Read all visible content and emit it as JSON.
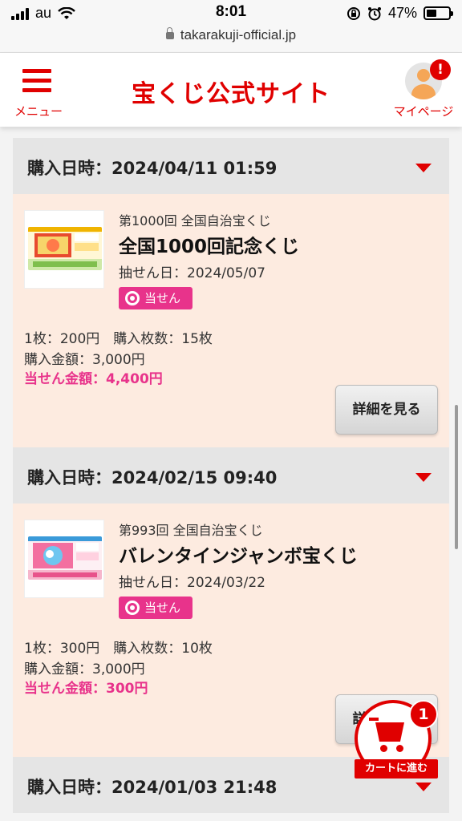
{
  "status_bar": {
    "carrier": "au",
    "time": "8:01",
    "battery": "47%",
    "battery_level": 0.47
  },
  "url_bar": {
    "url": "takarakuji-official.jp"
  },
  "header": {
    "menu_label": "メニュー",
    "logo": "宝くじ公式サイト",
    "mypage_label": "マイページ",
    "mypage_badge": "!"
  },
  "purchases": [
    {
      "date_label": "購入日時：2024/04/11 01:59",
      "series": "第1000回 全国自治宝くじ",
      "name": "全国1000回記念くじ",
      "draw_date": "抽せん日：2024/05/07",
      "result_badge": "当せん",
      "unit_info": "1枚：200円　購入枚数：15枚",
      "total": "購入金額：3,000円",
      "winnings": "当せん金額：4,400円",
      "detail_button": "詳細を見る"
    },
    {
      "date_label": "購入日時：2024/02/15 09:40",
      "series": "第993回 全国自治宝くじ",
      "name": "バレンタインジャンボ宝くじ",
      "draw_date": "抽せん日：2024/03/22",
      "result_badge": "当せん",
      "unit_info": "1枚：300円　購入枚数：10枚",
      "total": "購入金額：3,000円",
      "winnings": "当せん金額：300円",
      "detail_button": "詳細を見る"
    },
    {
      "date_label": "購入日時：2024/01/03 21:48"
    }
  ],
  "cart": {
    "label": "カートに進む",
    "count": "1"
  },
  "colors": {
    "brand_red": "#e00000",
    "win_pink": "#e8338b",
    "card_bg": "#fdebe0",
    "head_bg": "#e5e5e5"
  }
}
